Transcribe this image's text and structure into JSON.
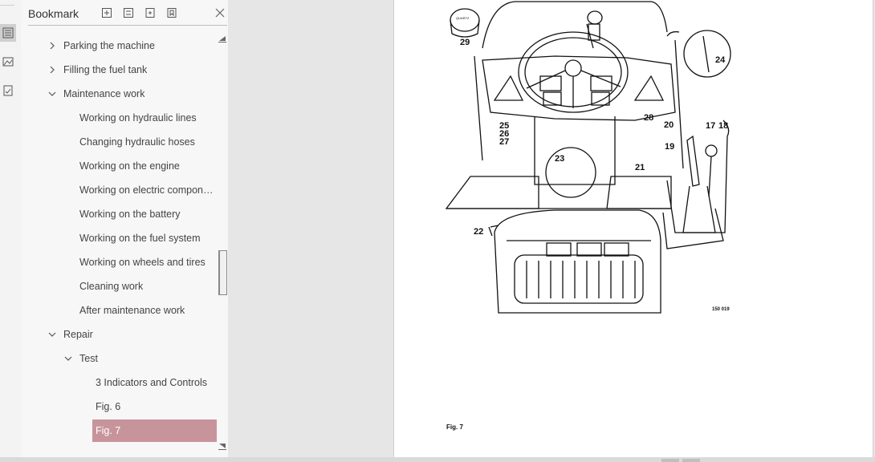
{
  "panel": {
    "title": "Bookmark",
    "items": [
      {
        "label": "Parking the machine",
        "level": 0,
        "chevron": "right"
      },
      {
        "label": "Filling the fuel tank",
        "level": 0,
        "chevron": "right"
      },
      {
        "label": "Maintenance work",
        "level": 0,
        "chevron": "down"
      },
      {
        "label": "Working on hydraulic lines",
        "level": 1,
        "chevron": "none"
      },
      {
        "label": "Changing hydraulic hoses",
        "level": 1,
        "chevron": "none"
      },
      {
        "label": "Working on the engine",
        "level": 1,
        "chevron": "none"
      },
      {
        "label": "Working on electric compone...",
        "level": 1,
        "chevron": "none"
      },
      {
        "label": "Working on the battery",
        "level": 1,
        "chevron": "none"
      },
      {
        "label": "Working on the fuel system",
        "level": 1,
        "chevron": "none"
      },
      {
        "label": "Working on wheels and tires",
        "level": 1,
        "chevron": "none"
      },
      {
        "label": "Cleaning work",
        "level": 1,
        "chevron": "none"
      },
      {
        "label": "After maintenance work",
        "level": 1,
        "chevron": "none"
      },
      {
        "label": "Repair",
        "level": 0,
        "chevron": "down"
      },
      {
        "label": "Test",
        "level": 1,
        "chevron": "down"
      },
      {
        "label": "3 Indicators and Controls",
        "level": 2,
        "chevron": "none"
      },
      {
        "label": "Fig. 6",
        "level": 2,
        "chevron": "none"
      },
      {
        "label": "Fig. 7",
        "level": 2,
        "chevron": "none",
        "selected": true
      }
    ]
  },
  "document": {
    "figure_caption": "Fig. 7",
    "figure_code": "150 019",
    "callouts": [
      "29",
      "24",
      "28",
      "25",
      "26",
      "27",
      "20",
      "17",
      "18",
      "19",
      "23",
      "21",
      "22"
    ],
    "gauge_text": "QUARTZ"
  },
  "icons": {
    "rail": [
      "bookmark-list-icon",
      "image-icon",
      "attachment-icon"
    ],
    "header": [
      "expand-all-icon",
      "collapse-all-icon",
      "add-bookmark-icon",
      "bookmark-options-icon",
      "close-icon"
    ]
  },
  "colors": {
    "selection": "#c8949c"
  }
}
